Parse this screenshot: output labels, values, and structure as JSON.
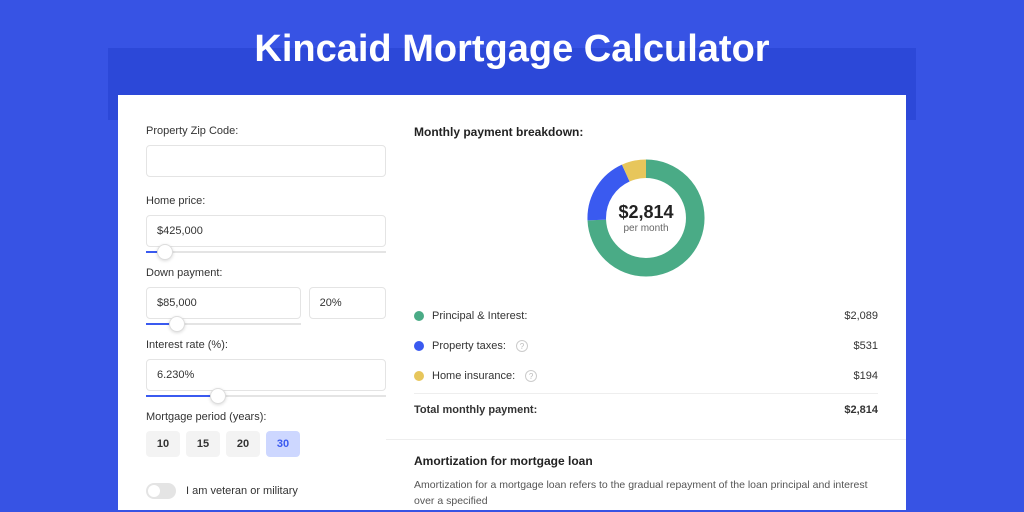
{
  "title": "Kincaid Mortgage Calculator",
  "form": {
    "zip_label": "Property Zip Code:",
    "zip_value": "",
    "home_price_label": "Home price:",
    "home_price_value": "$425,000",
    "home_price_slider_pct": 8,
    "down_payment_label": "Down payment:",
    "down_payment_value": "$85,000",
    "down_payment_pct_value": "20%",
    "down_payment_slider_pct": 20,
    "rate_label": "Interest rate (%):",
    "rate_value": "6.230%",
    "rate_slider_pct": 30,
    "period_label": "Mortgage period (years):",
    "periods": [
      "10",
      "15",
      "20",
      "30"
    ],
    "period_active_index": 3,
    "veteran_label": "I am veteran or military"
  },
  "breakdown": {
    "header": "Monthly payment breakdown:",
    "center_amount": "$2,814",
    "center_sub": "per month",
    "items": [
      {
        "label": "Principal & Interest:",
        "value": "$2,089",
        "color": "#4aab86",
        "has_info": false,
        "fraction": 0.742
      },
      {
        "label": "Property taxes:",
        "value": "$531",
        "color": "#3a5af0",
        "has_info": true,
        "fraction": 0.189
      },
      {
        "label": "Home insurance:",
        "value": "$194",
        "color": "#e7c65b",
        "has_info": true,
        "fraction": 0.069
      }
    ],
    "total_label": "Total monthly payment:",
    "total_value": "$2,814"
  },
  "amort": {
    "header": "Amortization for mortgage loan",
    "body": "Amortization for a mortgage loan refers to the gradual repayment of the loan principal and interest over a specified"
  },
  "chart_data": {
    "type": "pie",
    "title": "Monthly payment breakdown",
    "series": [
      {
        "name": "Principal & Interest",
        "value": 2089
      },
      {
        "name": "Property taxes",
        "value": 531
      },
      {
        "name": "Home insurance",
        "value": 194
      }
    ],
    "total": 2814,
    "unit": "USD per month"
  }
}
